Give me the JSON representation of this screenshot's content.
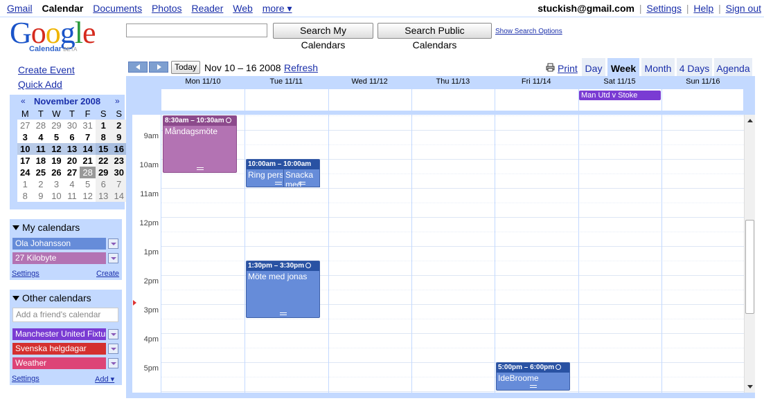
{
  "topnav": {
    "items": [
      "Gmail",
      "Calendar",
      "Documents",
      "Photos",
      "Reader",
      "Web",
      "more ▾"
    ],
    "account_email": "stuckish@gmail.com",
    "settings": "Settings",
    "help": "Help",
    "signout": "Sign out",
    "sep": "|"
  },
  "logo": {
    "word": "Google",
    "sub": "Calendar",
    "beta": "BETA"
  },
  "search": {
    "input_value": "",
    "my_calendars": "Search My Calendars",
    "public_calendars": "Search Public Calendars",
    "show_options": "Show Search Options"
  },
  "left": {
    "create_event": "Create Event",
    "quick_add": "Quick Add"
  },
  "mini_cal": {
    "month_label": "November 2008",
    "prev": "«",
    "next": "»",
    "dows": [
      "M",
      "T",
      "W",
      "T",
      "F",
      "S",
      "S"
    ],
    "weeks": [
      [
        "27",
        "28",
        "29",
        "30",
        "31",
        "1",
        "2"
      ],
      [
        "3",
        "4",
        "5",
        "6",
        "7",
        "8",
        "9"
      ],
      [
        "10",
        "11",
        "12",
        "13",
        "14",
        "15",
        "16"
      ],
      [
        "17",
        "18",
        "19",
        "20",
        "21",
        "22",
        "23"
      ],
      [
        "24",
        "25",
        "26",
        "27",
        "28",
        "29",
        "30"
      ],
      [
        "1",
        "2",
        "3",
        "4",
        "5",
        "6",
        "7"
      ],
      [
        "8",
        "9",
        "10",
        "11",
        "12",
        "13",
        "14"
      ]
    ]
  },
  "my_calendars": {
    "title": "My calendars",
    "items": [
      {
        "name": "Ola Johansson",
        "color": "#668cd9"
      },
      {
        "name": "27 Kilobyte",
        "color": "#b373b3"
      }
    ],
    "settings": "Settings",
    "create": "Create"
  },
  "other_calendars": {
    "title": "Other calendars",
    "placeholder": "Add a friend's calendar",
    "items": [
      {
        "name": "Manchester United Fixtures",
        "color": "#7a3bd3"
      },
      {
        "name": "Svenska helgdagar",
        "color": "#d4302f"
      },
      {
        "name": "Weather",
        "color": "#dd4477"
      }
    ],
    "settings": "Settings",
    "add": "Add ▾"
  },
  "toolbar": {
    "today": "Today",
    "date_range": "Nov 10 – 16 2008",
    "refresh": "Refresh",
    "print": "Print",
    "tabs": [
      "Day",
      "Week",
      "Month",
      "4 Days",
      "Agenda"
    ],
    "active_tab": "Week"
  },
  "week": {
    "days": [
      "Mon 11/10",
      "Tue 11/11",
      "Wed 11/12",
      "Thu 11/13",
      "Fri 11/14",
      "Sat 11/15",
      "Sun 11/16"
    ],
    "hours": [
      "9am",
      "10am",
      "11am",
      "12pm",
      "1pm",
      "2pm",
      "3pm",
      "4pm",
      "5pm"
    ]
  },
  "events": {
    "allday": {
      "title": "Man Utd v Stoke",
      "day": "Sat 11/15"
    },
    "e1": {
      "time": "8:30am – 10:30am",
      "title": "Måndagsmöte"
    },
    "e2": {
      "time": "10:00am – 10:00am",
      "title": "Ring pers"
    },
    "e3": {
      "time": "10:00am – 10:00am",
      "title": "Snacka med"
    },
    "e4": {
      "time": "1:30pm – 3:30pm",
      "title": "Möte med jonas"
    },
    "e5": {
      "time": "5:00pm – 6:00pm",
      "title": "IdeBroome"
    }
  }
}
